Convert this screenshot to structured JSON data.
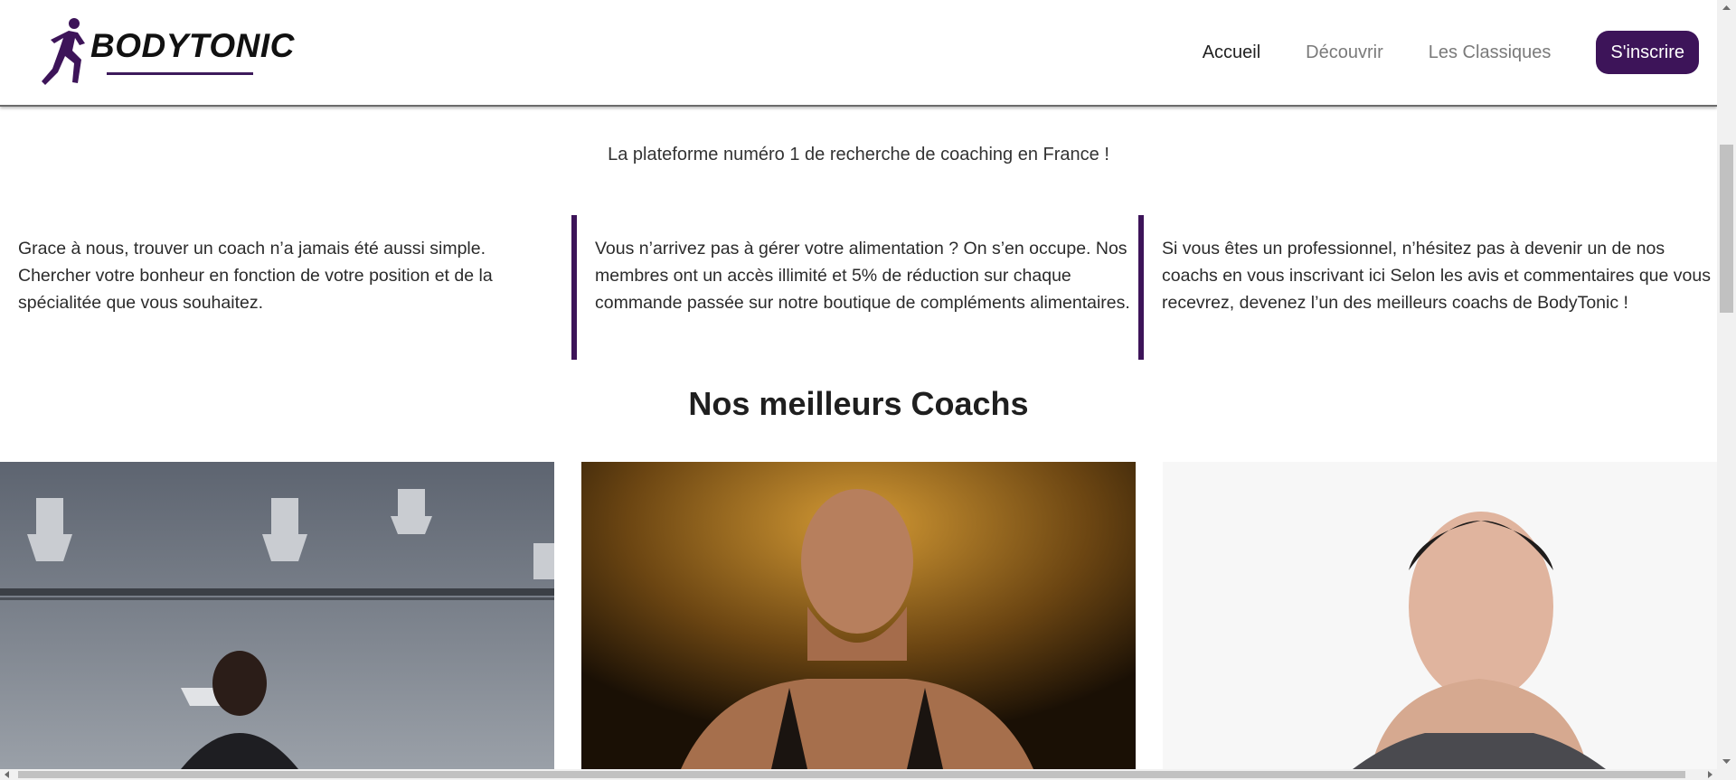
{
  "header": {
    "brand": "BODYTONIC",
    "nav": [
      {
        "label": "Accueil",
        "active": true
      },
      {
        "label": "Découvrir",
        "active": false
      },
      {
        "label": "Les Classiques",
        "active": false
      }
    ],
    "signup_label": "S'inscrire"
  },
  "tagline": "La plateforme numéro 1 de recherche de coaching en France !",
  "features": [
    {
      "text": "Grace à nous, trouver un coach n’a jamais été aussi simple. Chercher votre bonheur en fonction de votre position et de la spécialitée que vous souhaitez."
    },
    {
      "text": "Vous n’arrivez pas à gérer votre alimentation ? On s’en occupe. Nos membres ont un accès illimité et 5% de réduction sur chaque commande passée sur notre boutique de compléments alimentaires."
    },
    {
      "text": "Si vous êtes un professionnel, n’hésitez pas à devenir un de nos coachs en vous inscrivant ici Selon les avis et commentaires que vous recevrez, devenez l’un des meilleurs coachs de BodyTonic !"
    }
  ],
  "section_title": "Nos meilleurs Coachs",
  "coaches": [
    {
      "photo": "coach-photo-gym"
    },
    {
      "photo": "coach-photo-gold-background"
    },
    {
      "photo": "coach-photo-white-background"
    }
  ],
  "colors": {
    "brand_purple": "#3d1459",
    "nav_active": "#222222",
    "nav_inactive": "#7a7a7a"
  },
  "icons": {
    "logo": "runner-icon"
  }
}
